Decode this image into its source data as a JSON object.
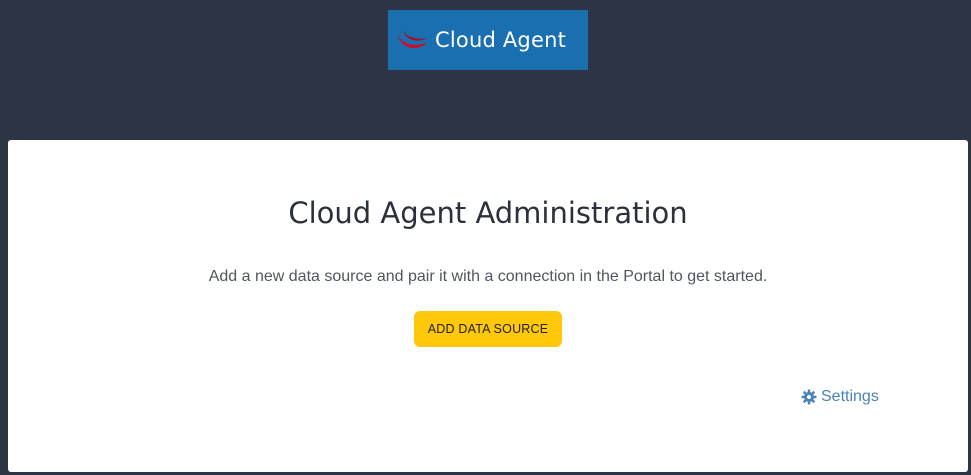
{
  "header": {
    "logo_text": "Cloud Agent",
    "logo_icon": "swoosh-logo-icon",
    "logo_bg": "#1a6fb0",
    "logo_accent": "#c8102e"
  },
  "main": {
    "title": "Cloud Agent Administration",
    "subtitle": "Add a new data source and pair it with a connection in the Portal to get started.",
    "add_button_label": "ADD DATA SOURCE",
    "add_button_color": "#ffc80a",
    "settings_label": "Settings",
    "settings_icon": "gear-icon",
    "link_color": "#4a82b8"
  },
  "colors": {
    "page_bg": "#2e3544",
    "card_bg": "#ffffff"
  }
}
